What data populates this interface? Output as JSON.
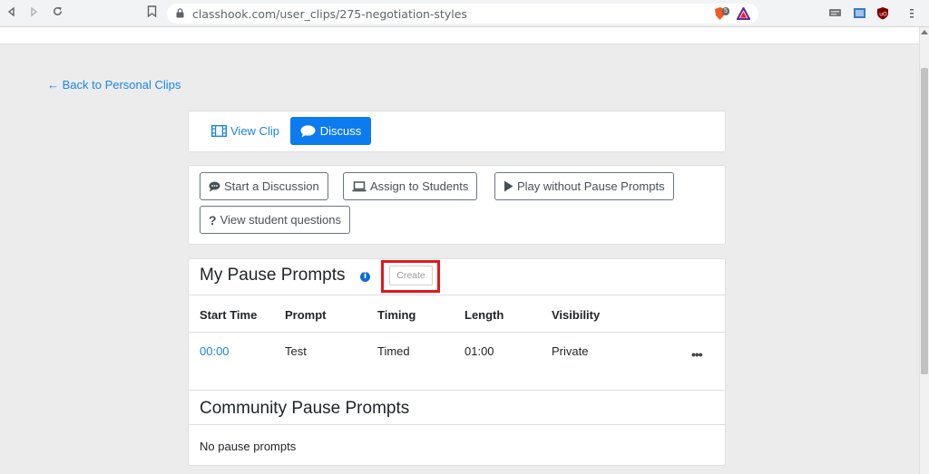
{
  "browser": {
    "url": "classhook.com/user_clips/275-negotiation-styles",
    "brave_badge": "5"
  },
  "page": {
    "back_link": "← Back to Personal Clips",
    "tabs": {
      "view_clip": "View Clip",
      "discuss": "Discuss"
    },
    "actions": {
      "start_discussion": "Start a Discussion",
      "assign_students": "Assign to Students",
      "play_without": "Play without Pause Prompts",
      "view_questions": "View student questions"
    },
    "my_prompts": {
      "title": "My Pause Prompts",
      "info": "i",
      "create_label": "Create",
      "columns": [
        "Start Time",
        "Prompt",
        "Timing",
        "Length",
        "Visibility"
      ],
      "rows": [
        {
          "start_time": "00:00",
          "prompt": "Test",
          "timing": "Timed",
          "length": "01:00",
          "visibility": "Private",
          "menu": "•••"
        }
      ]
    },
    "community_prompts": {
      "title": "Community Pause Prompts",
      "empty": "No pause prompts"
    }
  },
  "colors": {
    "link": "#1a86e5",
    "primary": "#0d7bf0",
    "highlight": "#e3171c",
    "background": "#ececec"
  }
}
